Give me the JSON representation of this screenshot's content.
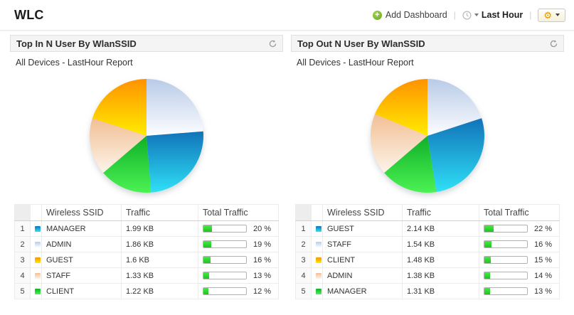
{
  "page_title": "WLC",
  "toolbar": {
    "add_dashboard_label": "Add Dashboard",
    "time_range_label": "Last Hour",
    "separator": "|"
  },
  "slice_colors": {
    "blue": [
      "#1173b9",
      "#2fe0f6"
    ],
    "lightblue": [
      "#b9cbe8",
      "#fcfdff"
    ],
    "green": [
      "#10b028",
      "#4bf253"
    ],
    "peach": [
      "#f2bf95",
      "#fdf4e9"
    ],
    "orange": [
      "#ff9200",
      "#ffec00"
    ]
  },
  "bar_colors": {
    "fill": "#2fdd2f",
    "track_border": "#b2b2b2"
  },
  "table_columns": [
    "Wireless SSID",
    "Traffic",
    "Total Traffic"
  ],
  "panels": [
    {
      "title": "Top In N User By WlanSSID",
      "subtitle": "All Devices - LastHour Report",
      "rows": [
        {
          "rank": "1",
          "color": "blue",
          "ssid": "MANAGER",
          "traffic": "1.99 KB",
          "percent": 20,
          "percent_label": "20 %"
        },
        {
          "rank": "2",
          "color": "lightblue",
          "ssid": "ADMIN",
          "traffic": "1.86 KB",
          "percent": 19,
          "percent_label": "19 %"
        },
        {
          "rank": "3",
          "color": "orange",
          "ssid": "GUEST",
          "traffic": "1.6 KB",
          "percent": 16,
          "percent_label": "16 %"
        },
        {
          "rank": "4",
          "color": "peach",
          "ssid": "STAFF",
          "traffic": "1.33 KB",
          "percent": 13,
          "percent_label": "13 %"
        },
        {
          "rank": "5",
          "color": "green",
          "ssid": "CLIENT",
          "traffic": "1.22 KB",
          "percent": 12,
          "percent_label": "12 %"
        }
      ],
      "chart_data": {
        "type": "pie",
        "title": "Top In N User By WlanSSID",
        "legend_position": "table-below",
        "direction": "clockwise",
        "start_angle_deg": 0,
        "slices_clockwise_from_top": [
          {
            "label": "ADMIN",
            "value": 19,
            "color": "lightblue"
          },
          {
            "label": "MANAGER",
            "value": 20,
            "color": "blue"
          },
          {
            "label": "CLIENT",
            "value": 12,
            "color": "green"
          },
          {
            "label": "STAFF",
            "value": 13,
            "color": "peach"
          },
          {
            "label": "GUEST",
            "value": 16,
            "color": "orange"
          }
        ]
      }
    },
    {
      "title": "Top Out N User By WlanSSID",
      "subtitle": "All Devices - LastHour Report",
      "rows": [
        {
          "rank": "1",
          "color": "blue",
          "ssid": "GUEST",
          "traffic": "2.14 KB",
          "percent": 22,
          "percent_label": "22 %"
        },
        {
          "rank": "2",
          "color": "lightblue",
          "ssid": "STAFF",
          "traffic": "1.54 KB",
          "percent": 16,
          "percent_label": "16 %"
        },
        {
          "rank": "3",
          "color": "orange",
          "ssid": "CLIENT",
          "traffic": "1.48 KB",
          "percent": 15,
          "percent_label": "15 %"
        },
        {
          "rank": "4",
          "color": "peach",
          "ssid": "ADMIN",
          "traffic": "1.38 KB",
          "percent": 14,
          "percent_label": "14 %"
        },
        {
          "rank": "5",
          "color": "green",
          "ssid": "MANAGER",
          "traffic": "1.31 KB",
          "percent": 13,
          "percent_label": "13 %"
        }
      ],
      "chart_data": {
        "type": "pie",
        "title": "Top Out N User By WlanSSID",
        "legend_position": "table-below",
        "direction": "clockwise",
        "start_angle_deg": 0,
        "slices_clockwise_from_top": [
          {
            "label": "STAFF",
            "value": 16,
            "color": "lightblue"
          },
          {
            "label": "GUEST",
            "value": 22,
            "color": "blue"
          },
          {
            "label": "MANAGER",
            "value": 13,
            "color": "green"
          },
          {
            "label": "ADMIN",
            "value": 14,
            "color": "peach"
          },
          {
            "label": "CLIENT",
            "value": 15,
            "color": "orange"
          }
        ]
      }
    }
  ]
}
